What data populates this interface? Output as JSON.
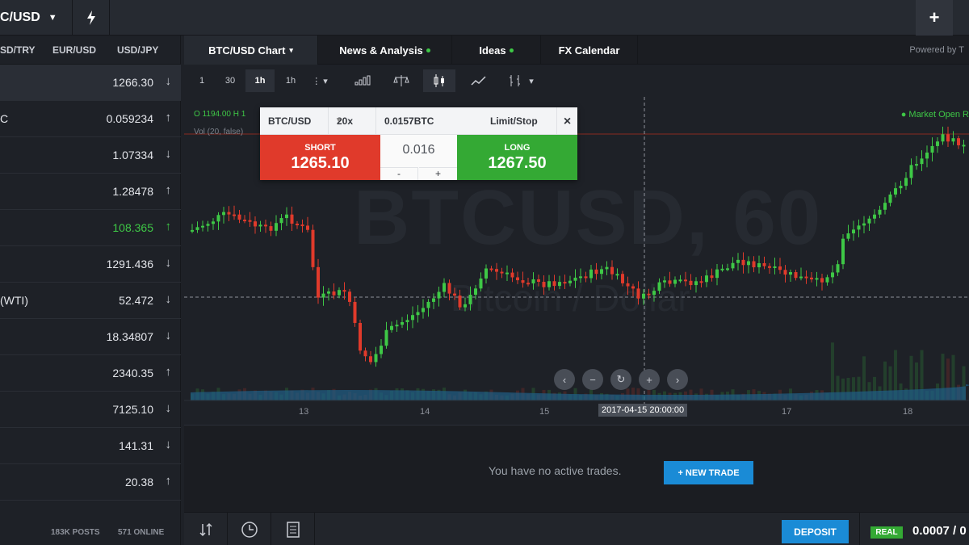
{
  "topbar": {
    "pair": "C/USD",
    "plus": "+"
  },
  "watchlist": {
    "tabs": [
      "SD/TRY",
      "EUR/USD",
      "USD/JPY"
    ],
    "rows": [
      {
        "name": "",
        "price": "1266.30",
        "dir": "↓",
        "selected": true
      },
      {
        "name": "C",
        "price": "0.059234",
        "dir": "↑"
      },
      {
        "name": "",
        "price": "1.07334",
        "dir": "↓"
      },
      {
        "name": "",
        "price": "1.28478",
        "dir": "↑"
      },
      {
        "name": "",
        "price": "108.365",
        "dir": "↑",
        "green": true
      },
      {
        "name": "",
        "price": "1291.436",
        "dir": "↓"
      },
      {
        "name": "(WTI)",
        "price": "52.472",
        "dir": "↓"
      },
      {
        "name": "",
        "price": "18.34807",
        "dir": "↓"
      },
      {
        "name": "",
        "price": "2340.35",
        "dir": "↑"
      },
      {
        "name": "",
        "price": "7125.10",
        "dir": "↓"
      },
      {
        "name": "",
        "price": "141.31",
        "dir": "↓"
      },
      {
        "name": "",
        "price": "20.38",
        "dir": "↑"
      }
    ],
    "posts": "183K POSTS",
    "online": "571 ONLINE"
  },
  "chart_tabs": {
    "chart": "BTC/USD Chart",
    "news": "News & Analysis",
    "ideas": "Ideas",
    "calendar": "FX Calendar",
    "powered": "Powered by T"
  },
  "toolbar": {
    "intervals": [
      "1",
      "30",
      "1h",
      "1h"
    ]
  },
  "chart": {
    "ohlc": "O 1194.00  H 1",
    "vol": "Vol (20, false)",
    "watermark": "BTCUSD, 60",
    "watermark_sub": "Bitcoin / Dollar",
    "market": "● Market Open  R",
    "time_label": "2017-04-15 20:00:00",
    "x_ticks": [
      "13",
      "14",
      "15",
      "17",
      "18"
    ]
  },
  "trade_widget": {
    "pair": "BTC/USD",
    "leverage": "20x",
    "size": "0.0157BTC",
    "order_type": "Limit/Stop",
    "close": "×",
    "short_label": "SHORT",
    "short_price": "1265.10",
    "long_label": "LONG",
    "long_price": "1267.50",
    "amount": "0.016",
    "minus": "-",
    "plus": "+"
  },
  "trades": {
    "empty_text": "You have no active trades.",
    "new_trade": "+ NEW TRADE"
  },
  "footer": {
    "deposit": "DEPOSIT",
    "mode": "REAL",
    "balance": "0.0007 / 0"
  },
  "colors": {
    "up": "#3ec846",
    "down": "#e03a2b",
    "accent": "#1a8bd6"
  }
}
